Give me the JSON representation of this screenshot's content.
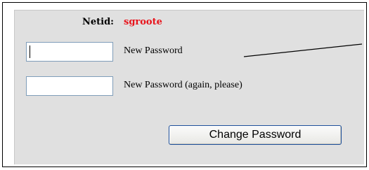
{
  "form": {
    "netid_label": "Netid:",
    "netid_value": "sgroote",
    "new_password_value": "",
    "new_password_label": "New Password",
    "confirm_password_value": "",
    "confirm_password_label": "New Password (again, please)",
    "submit_label": "Change Password"
  },
  "colors": {
    "panel_background": "#e0e0e0",
    "netid_value": "#e8141c",
    "input_border": "#7f9db9",
    "button_border": "#1d4f9a"
  }
}
